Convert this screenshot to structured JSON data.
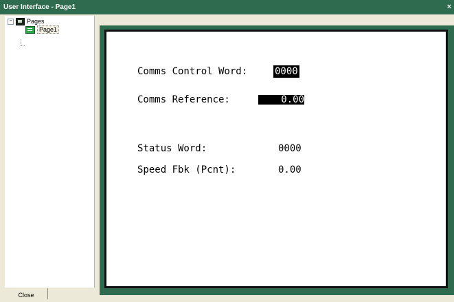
{
  "window": {
    "title": "User Interface - Page1",
    "close_glyph": "×"
  },
  "tree": {
    "root_label": "Pages",
    "root_expander": "−",
    "child_label": "Page1"
  },
  "screen": {
    "fields": [
      {
        "label": "Comms Control Word:",
        "value": "0000"
      },
      {
        "label": "Comms Reference:",
        "value": "0.00"
      },
      {
        "label": "Status Word:",
        "value": "0000"
      },
      {
        "label": "Speed Fbk (Pcnt):",
        "value": "0.00"
      }
    ]
  },
  "footer": {
    "close_label": "Close"
  },
  "colors": {
    "titlebar": "#2f6b4f",
    "frame": "#2f6b4f",
    "highlight_bg": "#000000",
    "highlight_fg": "#ffffff"
  }
}
